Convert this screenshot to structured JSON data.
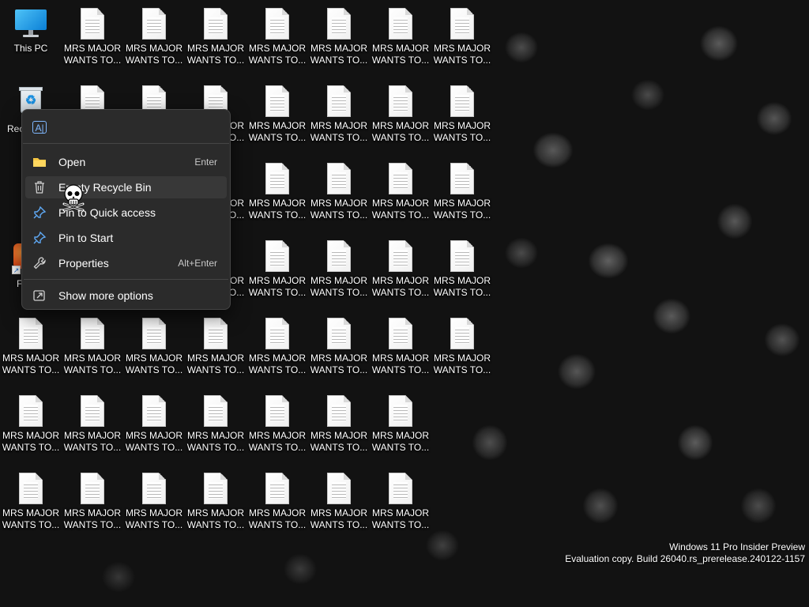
{
  "desktop": {
    "this_pc_label": "This PC",
    "recycle_bin_partial": "Rec",
    "app_partial": "F",
    "file_label_line1": "MRS MAJOR",
    "file_label_line2": "WANTS TO..."
  },
  "context_menu": {
    "items": [
      {
        "label": "Open",
        "shortcut": "Enter",
        "icon": "folder-icon"
      },
      {
        "label": "Empty Recycle Bin",
        "shortcut": "",
        "icon": "trash-icon"
      },
      {
        "label": "Pin to Quick access",
        "shortcut": "",
        "icon": "pin-icon"
      },
      {
        "label": "Pin to Start",
        "shortcut": "",
        "icon": "pin-icon"
      },
      {
        "label": "Properties",
        "shortcut": "Alt+Enter",
        "icon": "wrench-icon"
      },
      {
        "label": "Show more options",
        "shortcut": "",
        "icon": "share-icon"
      }
    ],
    "top_icon": "rename-icon"
  },
  "watermark": {
    "line1": "Windows 11 Pro Insider Preview",
    "line2": "Evaluation copy. Build 26040.rs_prerelease.240122-1157"
  }
}
